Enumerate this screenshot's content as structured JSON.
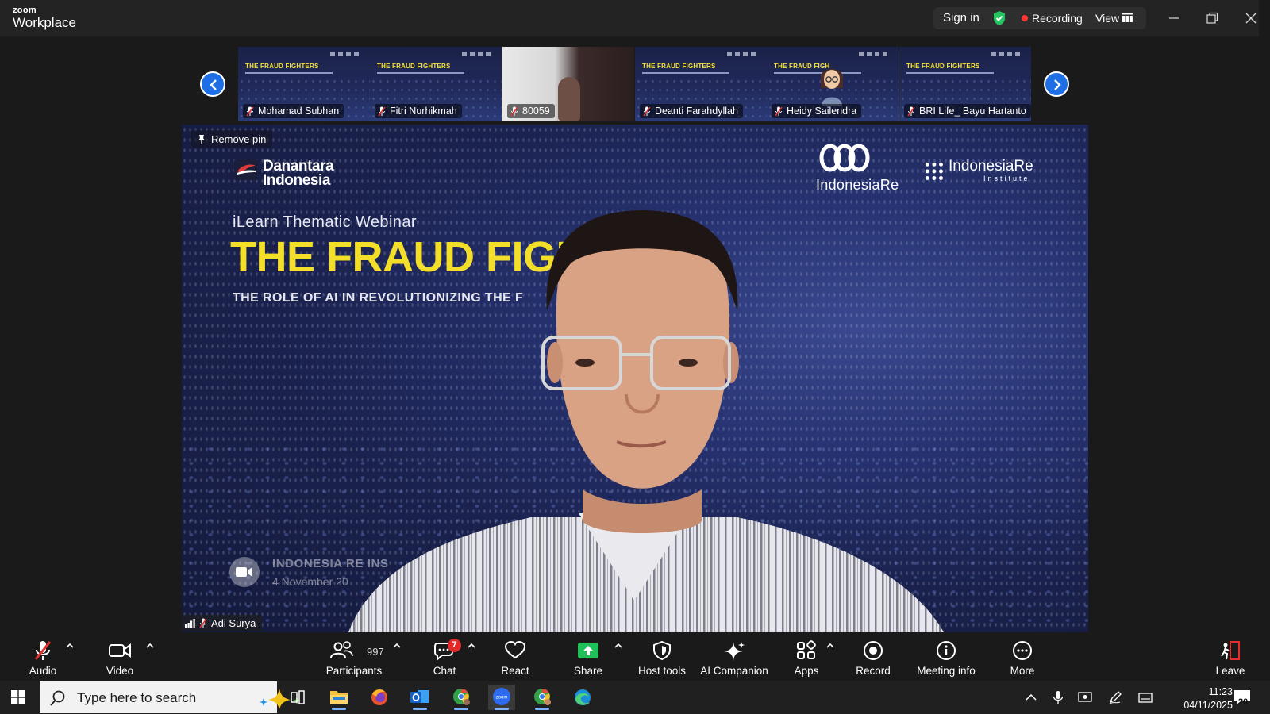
{
  "app": {
    "brand_small": "zoom",
    "brand_name": "Workplace",
    "sign_in": "Sign in",
    "recording": "Recording",
    "view": "View"
  },
  "strip": {
    "participants": [
      {
        "name": "Mohamad Subhan",
        "title": "THE FRAUD FIGHTERS"
      },
      {
        "name": "Fitri Nurhikmah",
        "title": "THE FRAUD FIGHTERS"
      },
      {
        "name": "80059"
      },
      {
        "name": "Deanti Farahdyllah",
        "title": "THE FRAUD FIGHTERS"
      },
      {
        "name": "Heidy Sailendra",
        "title": "THE FRAUD FIGH"
      },
      {
        "name": "BRI Life_ Bayu Hartanto",
        "title": "THE FRAUD FIGHTERS"
      }
    ]
  },
  "main": {
    "remove_pin": "Remove pin",
    "speaker_name": "Adi Surya",
    "slide": {
      "danantara_line1": "Danantara",
      "danantara_line2": "Indonesia",
      "indonesia_re": "IndonesiaRe",
      "iri_name": "IndonesiaRe",
      "iri_sub": "Institute",
      "webinar": "iLearn Thematic Webinar",
      "headline": "THE FRAUD FIGH",
      "subtitle": "THE ROLE OF AI IN REVOLUTIONIZING THE F",
      "org": "INDONESIA RE INS",
      "date": "4 November 20"
    }
  },
  "toolbar": {
    "audio": "Audio",
    "video": "Video",
    "participants": "Participants",
    "participant_count": "997",
    "chat": "Chat",
    "chat_badge": "7",
    "react": "React",
    "share": "Share",
    "host_tools": "Host tools",
    "ai_companion": "AI Companion",
    "apps": "Apps",
    "record": "Record",
    "meeting_info": "Meeting info",
    "more": "More",
    "leave": "Leave"
  },
  "taskbar": {
    "search_placeholder": "Type here to search",
    "time": "11:23",
    "date": "04/11/2025",
    "notifications": "20"
  },
  "colors": {
    "accent_blue": "#1e6fe6",
    "recording_red": "#f33",
    "shield_green": "#22c55e",
    "share_green": "#1fbf5a",
    "headline_yellow": "#f3df2a"
  }
}
